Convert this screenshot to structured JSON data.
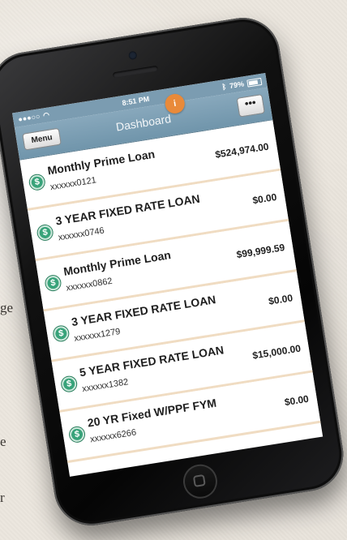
{
  "background": {
    "fragments": [
      "ge",
      "e",
      "r"
    ]
  },
  "status_bar": {
    "signal": "●●●○○",
    "time": "8:51 PM",
    "battery": "79%",
    "battery_level": 0.79
  },
  "nav": {
    "menu_label": "Menu",
    "title": "Dashboard",
    "more_label": "•••",
    "badge_label": "i"
  },
  "loans": [
    {
      "name": "Monthly Prime Loan",
      "account": "xxxxxx0121",
      "amount": "$524,974.00"
    },
    {
      "name": "3 YEAR FIXED RATE LOAN",
      "account": "xxxxxx0746",
      "amount": "$0.00"
    },
    {
      "name": "Monthly Prime Loan",
      "account": "xxxxxx0862",
      "amount": "$99,999.59"
    },
    {
      "name": "3 YEAR FIXED RATE LOAN",
      "account": "xxxxxx1279",
      "amount": "$0.00"
    },
    {
      "name": "5 YEAR FIXED RATE LOAN",
      "account": "xxxxxx1382",
      "amount": "$15,000.00"
    },
    {
      "name": "20 YR Fixed W/PPF FYM",
      "account": "xxxxxx6266",
      "amount": "$0.00"
    }
  ],
  "icons": {
    "loan_icon": "dollar-coin-icon",
    "glyph": "$"
  },
  "colors": {
    "nav": "#7b9cb1",
    "badge": "#e98a3a",
    "icon": "#38a37a",
    "row_divider": "#f0dcc2"
  }
}
